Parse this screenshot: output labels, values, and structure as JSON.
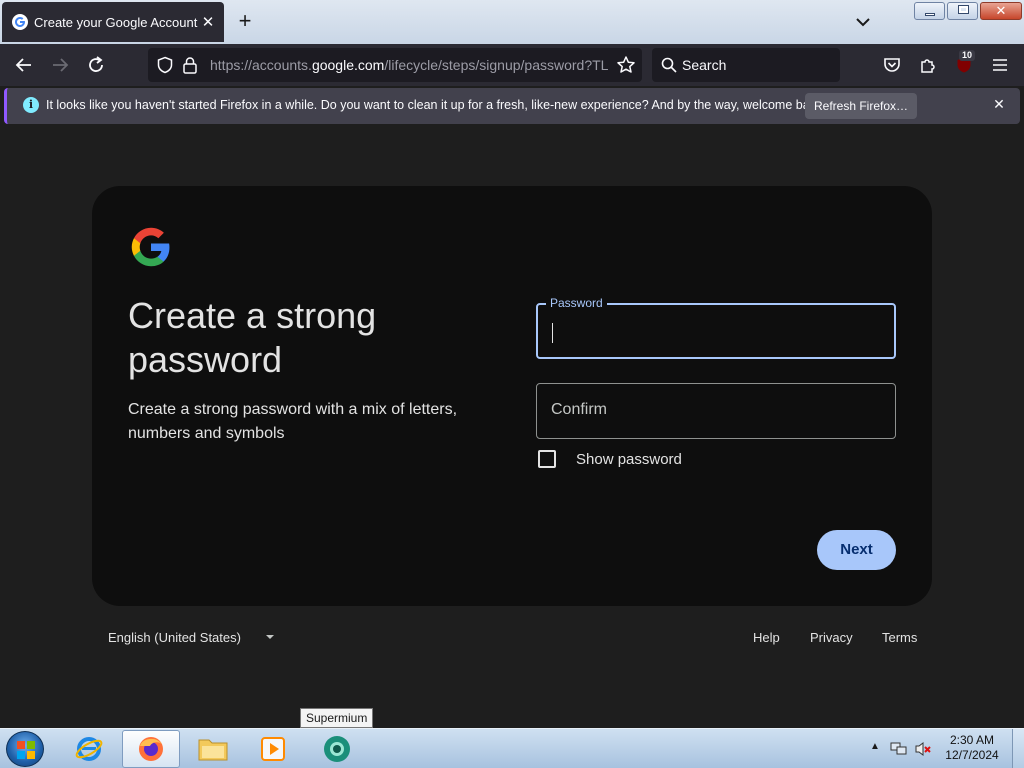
{
  "browser": {
    "tab_title": "Create your Google Account",
    "url_prefix": "https://accounts.",
    "url_domain": "google.com",
    "url_suffix": "/lifecycle/steps/signup/password?TL=",
    "search_label": "Search",
    "extension_badge": "10"
  },
  "notification": {
    "message": "It looks like you haven't started Firefox in a while. Do you want to clean it up for a fresh, like-new experience? And by the way, welcome back!",
    "button_label": "Refresh Firefox…"
  },
  "page": {
    "heading": "Create a strong password",
    "subheading": "Create a strong password with a mix of letters, numbers and symbols",
    "password_label": "Password",
    "password_value": "",
    "confirm_placeholder": "Confirm",
    "show_password_label": "Show password",
    "next_label": "Next"
  },
  "footer": {
    "language": "English (United States)",
    "help": "Help",
    "privacy": "Privacy",
    "terms": "Terms"
  },
  "taskbar": {
    "tooltip": "Supermium",
    "time": "2:30 AM",
    "date": "12/7/2024"
  },
  "colors": {
    "accent": "#a8c7fa",
    "card_bg": "#0e0e0e",
    "page_bg": "#1e1e1e",
    "browser_chrome": "#2b2a33"
  }
}
